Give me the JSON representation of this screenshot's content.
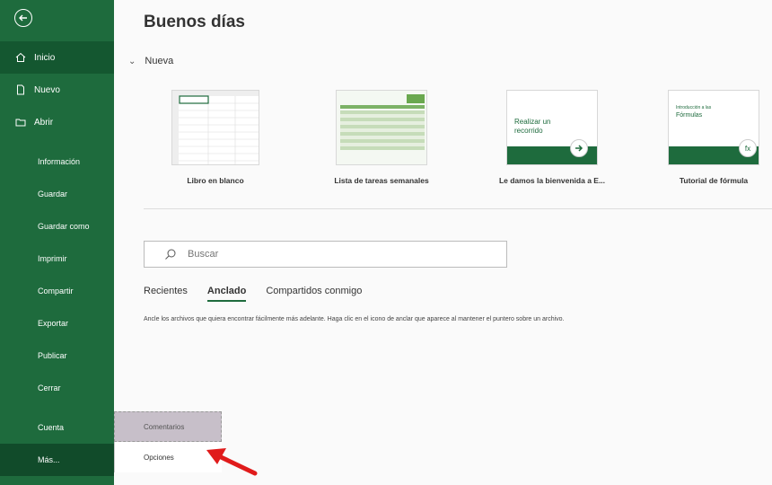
{
  "greeting": "Buenos días",
  "sidebar": {
    "top_items": [
      {
        "label": "Inicio",
        "icon": "home-icon"
      },
      {
        "label": "Nuevo",
        "icon": "new-file-icon"
      },
      {
        "label": "Abrir",
        "icon": "folder-icon"
      }
    ],
    "sub_items": [
      {
        "label": "Información"
      },
      {
        "label": "Guardar"
      },
      {
        "label": "Guardar como"
      },
      {
        "label": "Imprimir"
      },
      {
        "label": "Compartir"
      },
      {
        "label": "Exportar"
      },
      {
        "label": "Publicar"
      },
      {
        "label": "Cerrar"
      }
    ],
    "bottom_items": [
      {
        "label": "Cuenta"
      },
      {
        "label": "Más..."
      }
    ]
  },
  "new_section": {
    "title": "Nueva",
    "templates": [
      {
        "label": "Libro en blanco"
      },
      {
        "label": "Lista de tareas semanales"
      },
      {
        "label": "Le damos la bienvenida a E...",
        "thumb_text": "Realizar un recorrido"
      },
      {
        "label": "Tutorial de fórmula",
        "thumb_small": "Introducción a las",
        "thumb_text": "Fórmulas"
      }
    ]
  },
  "search": {
    "placeholder": "Buscar"
  },
  "tabs": [
    {
      "label": "Recientes"
    },
    {
      "label": "Anclado"
    },
    {
      "label": "Compartidos conmigo"
    }
  ],
  "pinned_message": "Ancle los archivos que quiera encontrar fácilmente más adelante. Haga clic en el icono de anclar que aparece al mantener el puntero sobre un archivo.",
  "popup_menu": [
    {
      "label": "Comentarios"
    },
    {
      "label": "Opciones"
    }
  ],
  "colors": {
    "accent": "#1e6b3d",
    "arrow": "#e01b1b"
  }
}
